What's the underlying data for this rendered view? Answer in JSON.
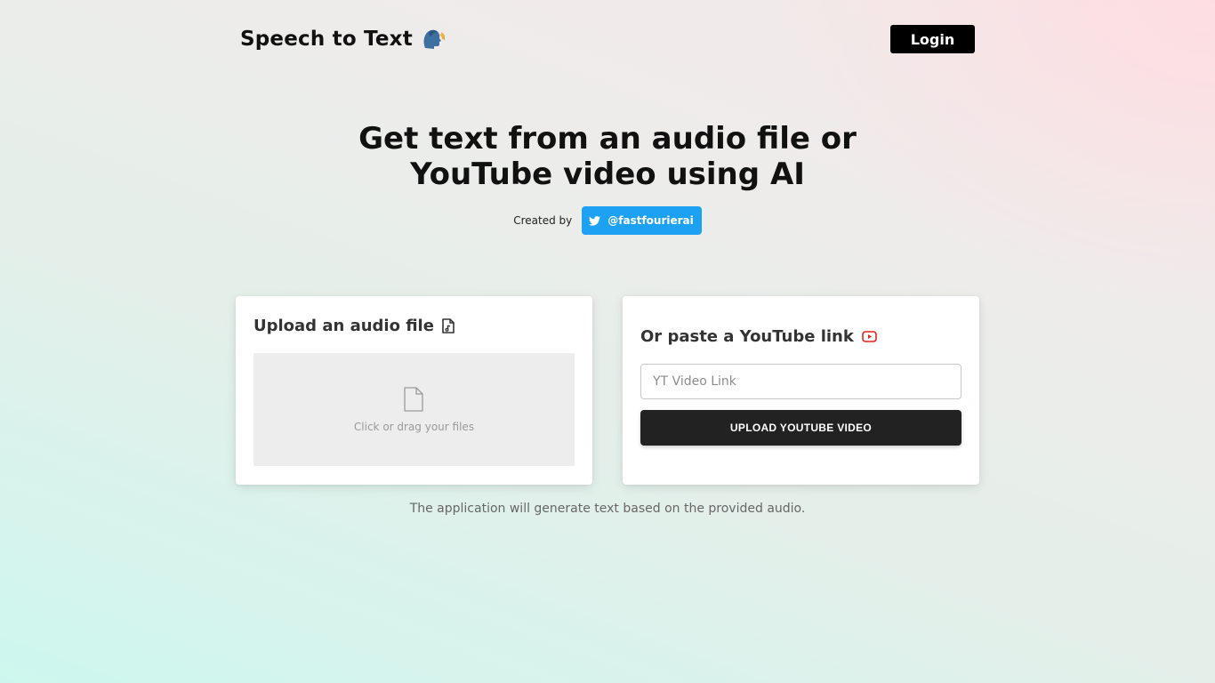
{
  "header": {
    "brand_title": "Speech to Text",
    "brand_icon": "speaking-head-emoji",
    "login_label": "Login"
  },
  "hero": {
    "title_line1": "Get text from an audio file or",
    "title_line2": "YouTube video using AI",
    "created_by_label": "Created by",
    "twitter_handle": "@fastfourierai",
    "twitter_icon": "twitter-bird-icon"
  },
  "upload_card": {
    "title": "Upload an audio file",
    "title_icon": "audio-file-icon",
    "dropzone_icon": "file-icon",
    "dropzone_text": "Click or drag your files"
  },
  "youtube_card": {
    "title": "Or paste a YouTube link",
    "title_icon": "youtube-icon",
    "input_placeholder": "YT Video Link",
    "input_value": "",
    "button_label": "UPLOAD YOUTUBE VIDEO"
  },
  "footer": {
    "note": "The application will generate text based on the provided audio."
  },
  "colors": {
    "twitter_blue": "#1da1f2",
    "youtube_red": "#e62117",
    "button_dark": "#222222",
    "login_black": "#000000"
  }
}
